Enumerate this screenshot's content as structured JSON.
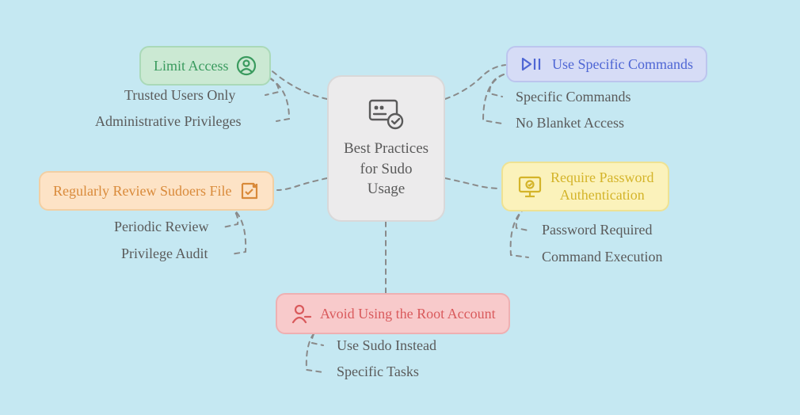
{
  "center": {
    "title": "Best Practices for Sudo Usage"
  },
  "nodes": {
    "limit_access": {
      "label": "Limit Access",
      "subs": [
        "Trusted Users Only",
        "Administrative Privileges"
      ]
    },
    "specific_commands": {
      "label": "Use Specific Commands",
      "subs": [
        "Specific Commands",
        "No Blanket Access"
      ]
    },
    "review_sudoers": {
      "label": "Regularly Review Sudoers File",
      "subs": [
        "Periodic Review",
        "Privilege Audit"
      ]
    },
    "password_auth": {
      "label": "Require Password Authentication",
      "subs": [
        "Password Required",
        "Command Execution"
      ]
    },
    "avoid_root": {
      "label": "Avoid Using the Root Account",
      "subs": [
        "Use Sudo Instead",
        "Specific Tasks"
      ]
    }
  }
}
